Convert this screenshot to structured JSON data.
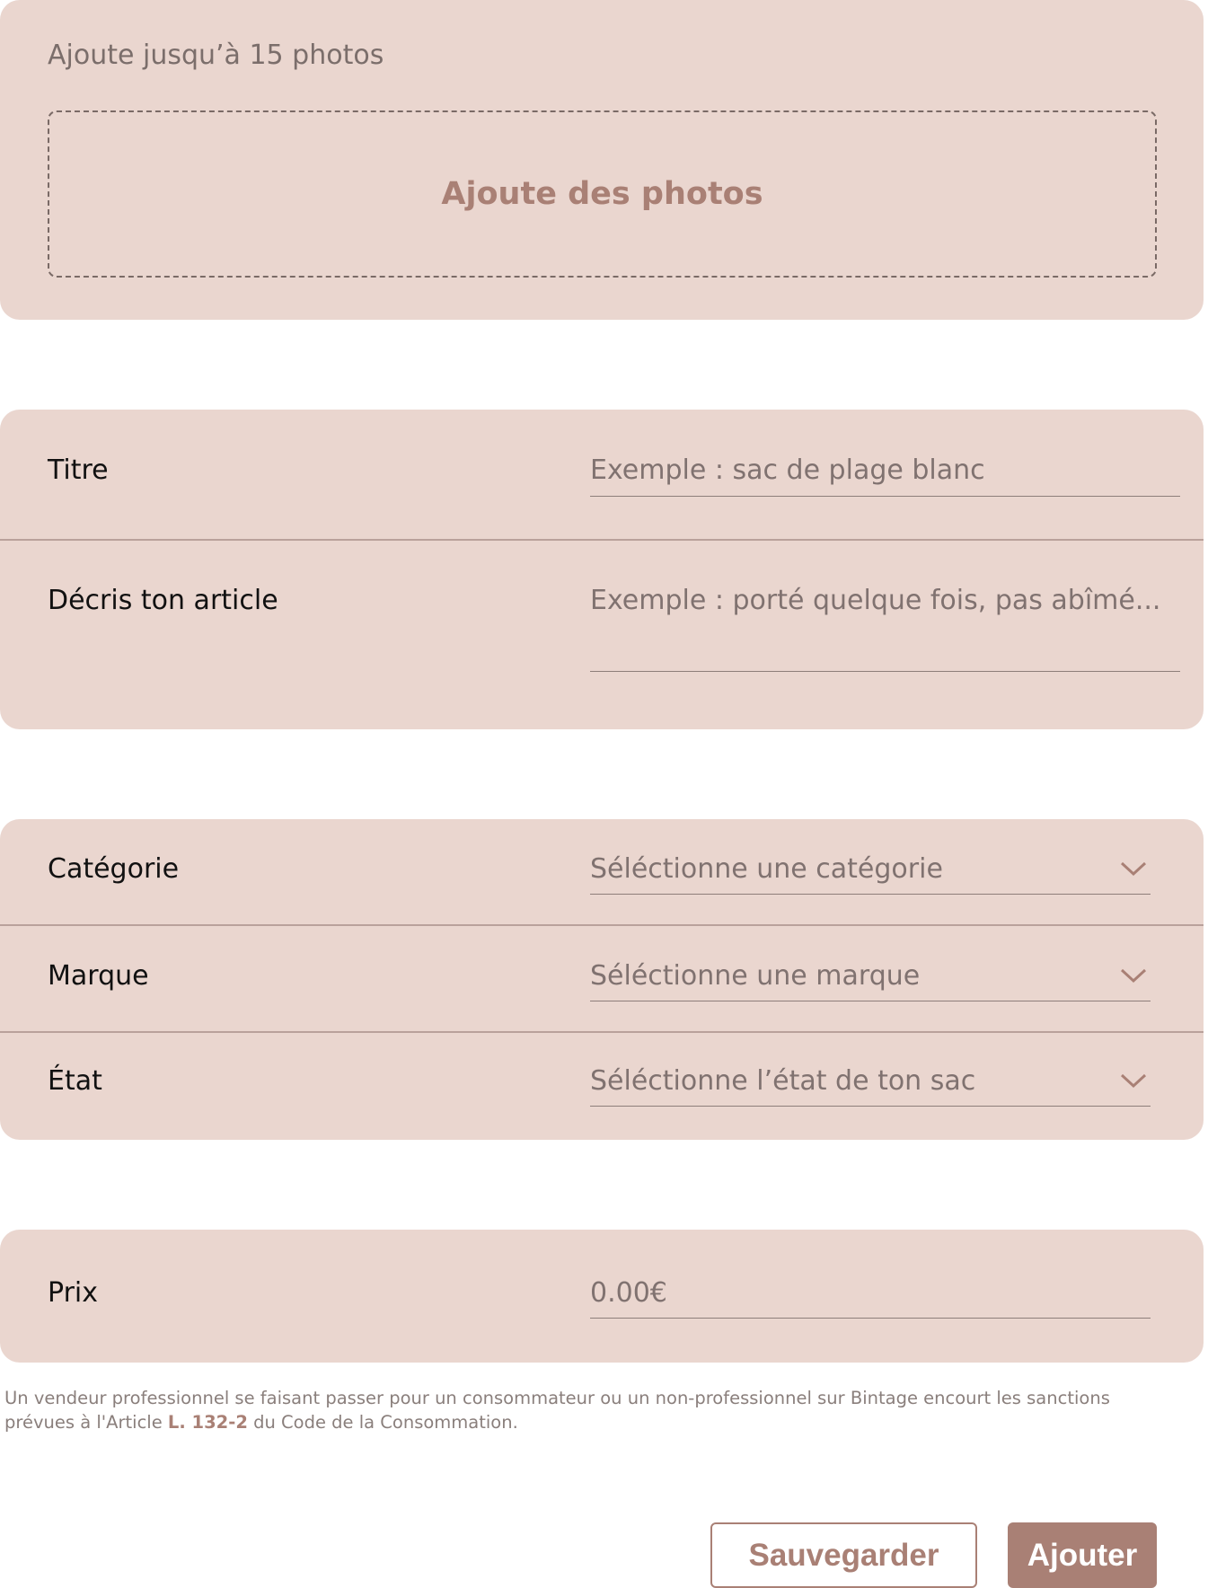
{
  "photos": {
    "hint": "Ajoute jusqu’à 15 photos",
    "dropzone_label": "Ajoute des photos"
  },
  "title_field": {
    "label": "Titre",
    "placeholder": "Exemple : sac de plage blanc"
  },
  "description_field": {
    "label": "Décris ton article",
    "placeholder": "Exemple : porté quelque fois, pas abîmé..."
  },
  "category_field": {
    "label": "Catégorie",
    "placeholder": "Séléctionne une catégorie"
  },
  "brand_field": {
    "label": "Marque",
    "placeholder": "Séléctionne une marque"
  },
  "condition_field": {
    "label": "État",
    "placeholder": "Séléctionne l’état de ton sac"
  },
  "price_field": {
    "label": "Prix",
    "placeholder": "0.00€"
  },
  "legal": {
    "text_before": "Un vendeur professionnel se faisant passer pour un consommateur ou un non-professionnel sur Bintage encourt les sanctions prévues à l'Article ",
    "article": "L. 132-2",
    "text_after": " du Code de la Consommation."
  },
  "actions": {
    "save_label": "Sauvegarder",
    "add_label": "Ajouter"
  },
  "colors": {
    "card_background": "#ead6cf",
    "accent": "#a98075",
    "divider": "#b9a19b"
  },
  "icons": {
    "select_chevron": "chevron-down-icon"
  }
}
